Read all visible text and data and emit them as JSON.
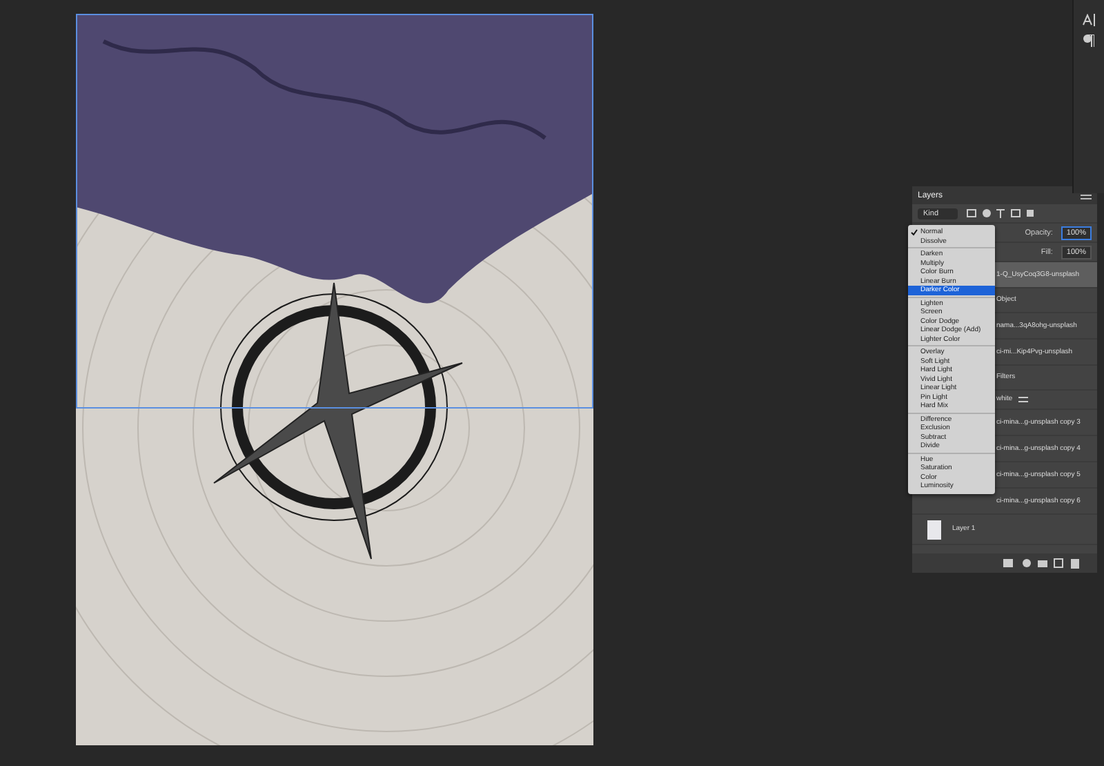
{
  "panel": {
    "title": "Layers",
    "filter": "Kind",
    "opacity_label": "Opacity:",
    "opacity": "100%",
    "fill_label": "Fill:",
    "fill": "100%"
  },
  "layers": [
    {
      "name": "1-Q_UsyCoq3G8-unsplash",
      "kind": "layer",
      "selected": true
    },
    {
      "name": "Object",
      "kind": "sub",
      "selected": false
    },
    {
      "name": "nama...3qA8ohg-unsplash",
      "kind": "layer",
      "selected": false
    },
    {
      "name": "ci-mi...Kip4Pvg-unsplash",
      "kind": "layer",
      "selected": false
    },
    {
      "name": "Filters",
      "kind": "sub",
      "selected": false
    },
    {
      "name": "white",
      "kind": "effect",
      "selected": false
    },
    {
      "name": "ci-mina...g-unsplash copy 3",
      "kind": "layer",
      "selected": false
    },
    {
      "name": "ci-mina...g-unsplash copy 4",
      "kind": "layer",
      "selected": false
    },
    {
      "name": "ci-mina...g-unsplash copy 5",
      "kind": "layer",
      "selected": false
    },
    {
      "name": "ci-mina...g-unsplash copy 6",
      "kind": "layer",
      "selected": false
    },
    {
      "name": "Layer 1",
      "kind": "base",
      "selected": false
    }
  ],
  "blend_menu": [
    [
      {
        "label": "Normal",
        "checked": true,
        "selected": false
      },
      {
        "label": "Dissolve",
        "checked": false,
        "selected": false
      }
    ],
    [
      {
        "label": "Darken",
        "checked": false,
        "selected": false
      },
      {
        "label": "Multiply",
        "checked": false,
        "selected": false
      },
      {
        "label": "Color Burn",
        "checked": false,
        "selected": false
      },
      {
        "label": "Linear Burn",
        "checked": false,
        "selected": false
      },
      {
        "label": "Darker Color",
        "checked": false,
        "selected": true
      }
    ],
    [
      {
        "label": "Lighten",
        "checked": false,
        "selected": false
      },
      {
        "label": "Screen",
        "checked": false,
        "selected": false
      },
      {
        "label": "Color Dodge",
        "checked": false,
        "selected": false
      },
      {
        "label": "Linear Dodge (Add)",
        "checked": false,
        "selected": false
      },
      {
        "label": "Lighter Color",
        "checked": false,
        "selected": false
      }
    ],
    [
      {
        "label": "Overlay",
        "checked": false,
        "selected": false
      },
      {
        "label": "Soft Light",
        "checked": false,
        "selected": false
      },
      {
        "label": "Hard Light",
        "checked": false,
        "selected": false
      },
      {
        "label": "Vivid Light",
        "checked": false,
        "selected": false
      },
      {
        "label": "Linear Light",
        "checked": false,
        "selected": false
      },
      {
        "label": "Pin Light",
        "checked": false,
        "selected": false
      },
      {
        "label": "Hard Mix",
        "checked": false,
        "selected": false
      }
    ],
    [
      {
        "label": "Difference",
        "checked": false,
        "selected": false
      },
      {
        "label": "Exclusion",
        "checked": false,
        "selected": false
      },
      {
        "label": "Subtract",
        "checked": false,
        "selected": false
      },
      {
        "label": "Divide",
        "checked": false,
        "selected": false
      }
    ],
    [
      {
        "label": "Hue",
        "checked": false,
        "selected": false
      },
      {
        "label": "Saturation",
        "checked": false,
        "selected": false
      },
      {
        "label": "Color",
        "checked": false,
        "selected": false
      },
      {
        "label": "Luminosity",
        "checked": false,
        "selected": false
      }
    ]
  ]
}
